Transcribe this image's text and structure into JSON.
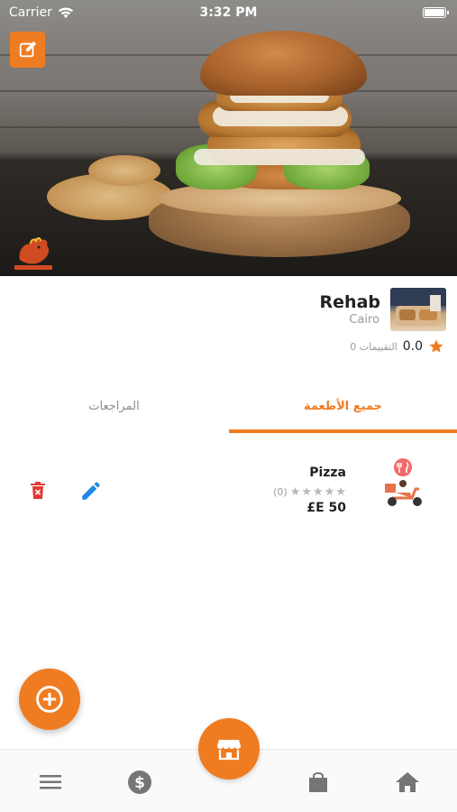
{
  "status_bar": {
    "carrier": "Carrier",
    "time": "3:32 PM",
    "wifi_icon": "wifi-icon",
    "battery_icon": "battery-icon"
  },
  "hero": {
    "image": "burger-photo",
    "edit_icon": "edit-icon",
    "logo": "rooster-logo"
  },
  "store": {
    "name": "Rehab",
    "city": "Cairo",
    "rating": "0.0",
    "reviews_label": "0 التقييمات",
    "star_icon": "star-icon"
  },
  "tabs": {
    "all_food": "جميع الأطعمة",
    "reviews": "المراجعات",
    "active": "all_food"
  },
  "products": [
    {
      "name": "Pizza",
      "review_count": "(0)",
      "stars": 0,
      "price": "£E 50",
      "image": "delivery-scooter-icon"
    }
  ],
  "fab": {
    "add_icon": "add-circle-icon",
    "store_icon": "storefront-icon"
  },
  "bottom_nav": {
    "items": [
      "menu-icon",
      "dollar-icon",
      "shopping-bag-icon",
      "home-icon"
    ]
  },
  "colors": {
    "accent": "#f07c22",
    "delete": "#e53935",
    "edit": "#1e88e5",
    "muted": "#9a9a9a"
  }
}
